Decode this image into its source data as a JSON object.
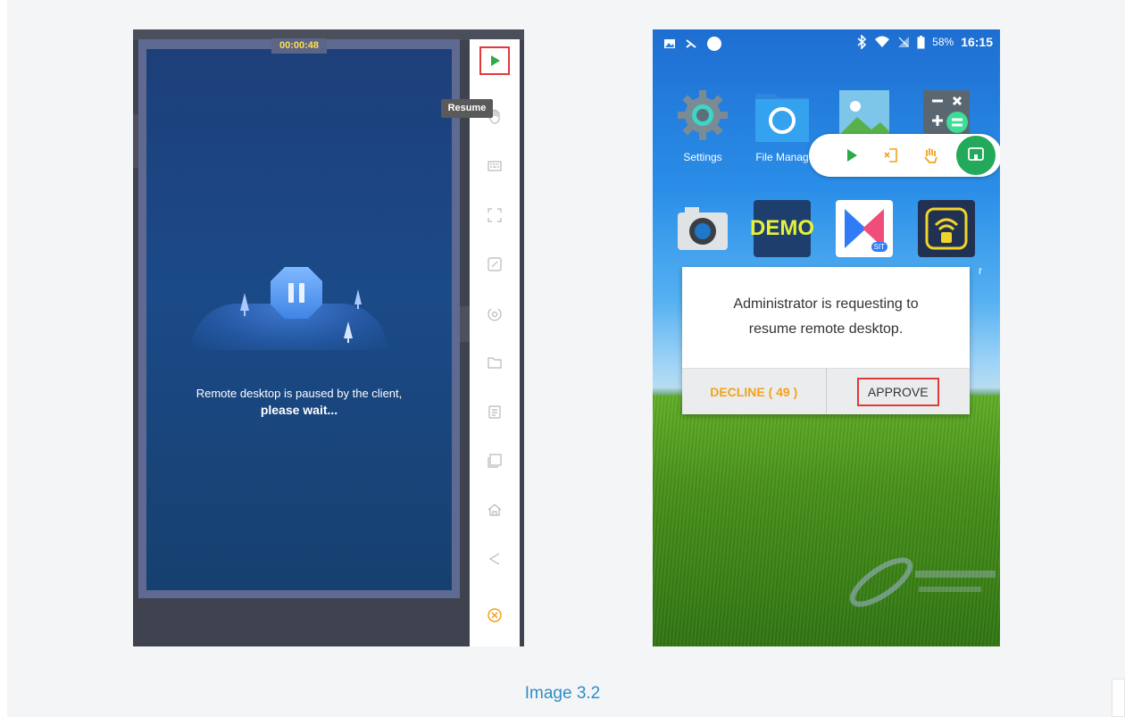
{
  "left_viewer": {
    "timer": "00:00:48",
    "paused_message": "Remote desktop is paused by the client,",
    "paused_wait": "please wait...",
    "tooltip": "Resume",
    "toolbar": [
      {
        "name": "resume-play-icon",
        "icon": "play",
        "color": "#2eaa4a"
      },
      {
        "name": "touch-icon",
        "icon": "hand"
      },
      {
        "name": "keyboard-icon",
        "icon": "keyboard"
      },
      {
        "name": "screenshot-icon",
        "icon": "crop"
      },
      {
        "name": "draw-icon",
        "icon": "pen"
      },
      {
        "name": "record-icon",
        "icon": "record"
      },
      {
        "name": "folder-icon",
        "icon": "folder"
      },
      {
        "name": "clipboard-icon",
        "icon": "clipboard"
      },
      {
        "name": "recent-apps-icon",
        "icon": "square"
      },
      {
        "name": "home-icon",
        "icon": "home"
      },
      {
        "name": "back-icon",
        "icon": "back"
      },
      {
        "name": "close-session-icon",
        "icon": "close-circle",
        "color": "#f3a21b"
      }
    ]
  },
  "phone": {
    "status": {
      "battery": "58%",
      "time": "16:15"
    },
    "apps_row1": [
      {
        "name": "settings",
        "label": "Settings"
      },
      {
        "name": "file-manager",
        "label": "File Manag"
      },
      {
        "name": "gallery",
        "label": ""
      },
      {
        "name": "calculator",
        "label": ""
      }
    ],
    "apps_row2": [
      {
        "name": "camera",
        "label": ""
      },
      {
        "name": "demo",
        "label": "",
        "text": "DEMO"
      },
      {
        "name": "sit-app",
        "label": "",
        "badge": "SIT"
      },
      {
        "name": "remote-receiver",
        "label": "r"
      }
    ],
    "dialog": {
      "line1": "Administrator is requesting to",
      "line2": "resume remote desktop.",
      "decline": "DECLINE ( 49 )",
      "approve": "APPROVE"
    }
  },
  "caption": "Image 3.2",
  "colors": {
    "accent_red": "#e03a3a",
    "green": "#22a95a",
    "orange": "#f3a21b",
    "caption_blue": "#2d8ec7"
  }
}
